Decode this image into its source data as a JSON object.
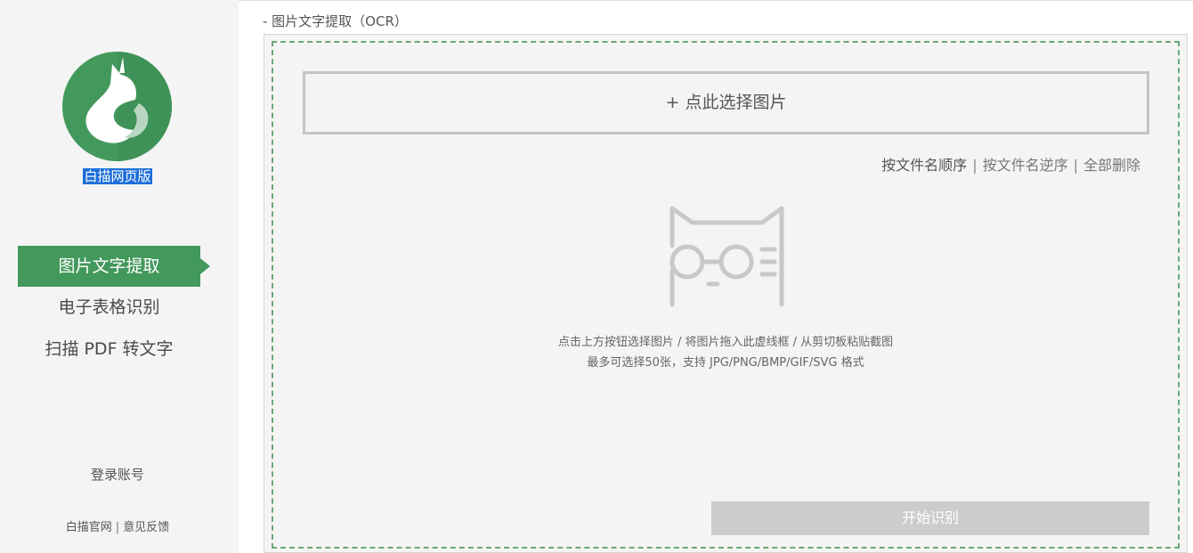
{
  "sidebar": {
    "logo_icon": "baimiao-cat-logo",
    "app_name": "白描网页版",
    "nav": [
      {
        "label": "图片文字提取",
        "active": true
      },
      {
        "label": "电子表格识别",
        "active": false
      },
      {
        "label": "扫描 PDF 转文字",
        "active": false
      }
    ],
    "login_label": "登录账号",
    "footer": {
      "official_site": "白描官网",
      "separator": "|",
      "feedback": "意见反馈"
    }
  },
  "main": {
    "section_title": "- 图片文字提取（OCR）",
    "select_button_label": "+ 点此选择图片",
    "sort": {
      "by_name_asc": "按文件名顺序",
      "by_name_desc": "按文件名逆序",
      "delete_all": "全部删除",
      "separator": "|"
    },
    "illustration_icon": "cat-with-glasses-icon",
    "hint_line1": "点击上方按钮选择图片 / 将图片拖入此虚线框 / 从剪切板粘贴截图",
    "hint_line2": "最多可选择50张，支持 JPG/PNG/BMP/GIF/SVG 格式",
    "start_button_label": "开始识别"
  },
  "colors": {
    "brand_green": "#43995c",
    "dashed_border": "#67a877",
    "disabled_button": "#cccccc",
    "selection_highlight": "#1e6fd9"
  }
}
